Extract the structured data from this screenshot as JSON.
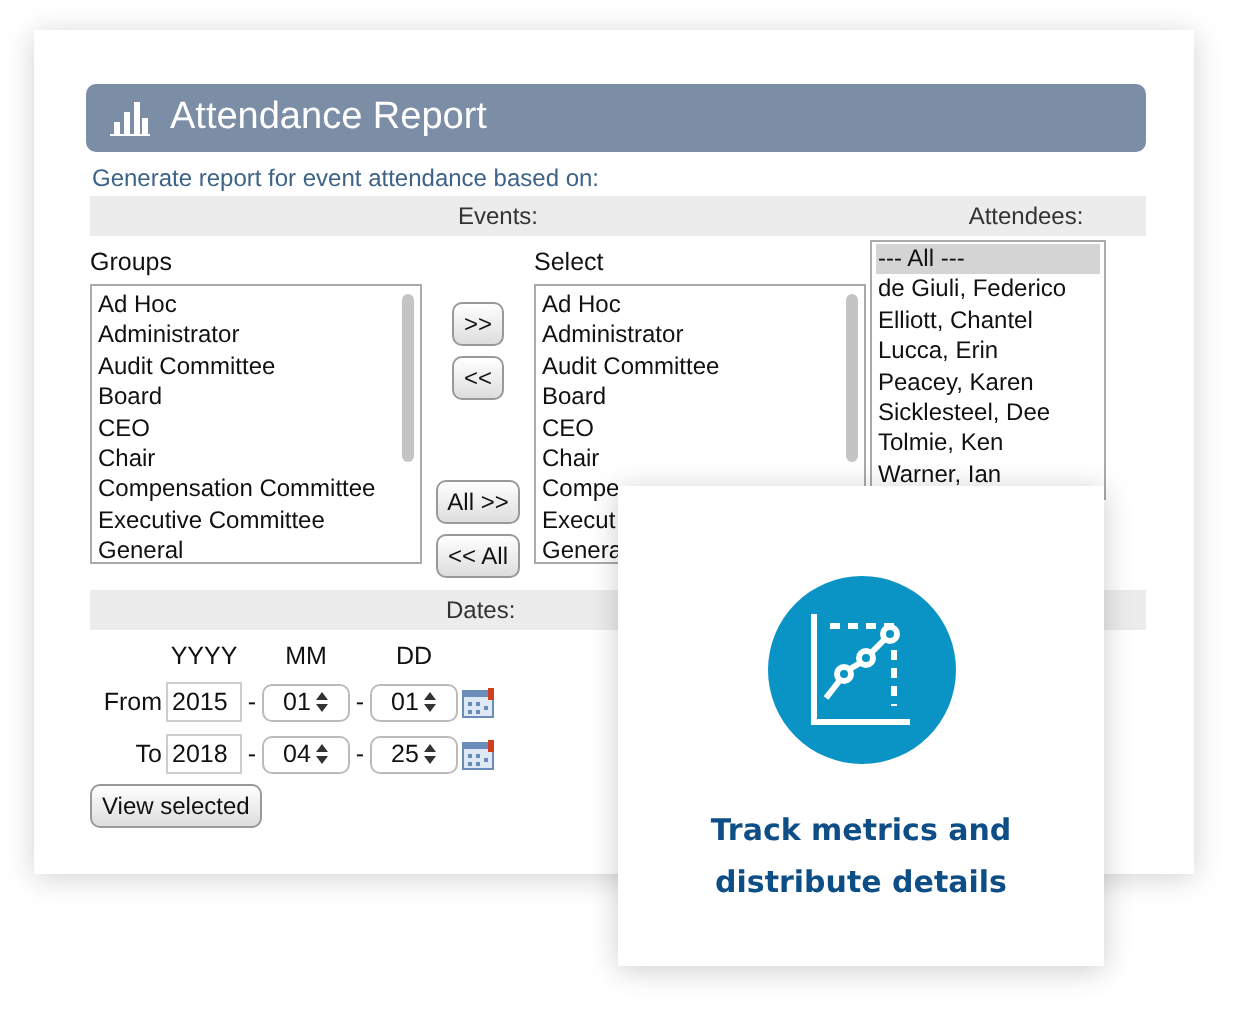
{
  "header": {
    "title": "Attendance Report"
  },
  "intro": "Generate report for event attendance based on:",
  "events": {
    "label": "Events:",
    "attendees_label": "Attendees:"
  },
  "groups": {
    "label": "Groups",
    "items": [
      "Ad Hoc",
      "Administrator",
      "Audit Committee",
      "Board",
      "CEO",
      "Chair",
      "Compensation Committee",
      "Executive Committee",
      "General"
    ]
  },
  "buttons": [
    ">>",
    "<<",
    "All >>",
    "<< All"
  ],
  "select": {
    "label": "Select",
    "items": [
      "Ad Hoc",
      "Administrator",
      "Audit Committee",
      "Board",
      "CEO",
      "Chair",
      "Compe",
      "Execut",
      "Genera"
    ]
  },
  "attendees": [
    {
      "name": "--- All ---",
      "selected": true
    },
    {
      "name": "de Giuli, Federico",
      "selected": false
    },
    {
      "name": "Elliott, Chantel",
      "selected": false
    },
    {
      "name": "Lucca, Erin",
      "selected": false
    },
    {
      "name": "Peacey, Karen",
      "selected": false
    },
    {
      "name": "Sicklesteel, Dee",
      "selected": false
    },
    {
      "name": "Tolmie, Ken",
      "selected": false
    },
    {
      "name": "Warner, Ian",
      "selected": false
    }
  ],
  "dates": {
    "label": "Dates:",
    "columns": [
      "YYYY",
      "MM",
      "DD"
    ],
    "rows": [
      {
        "label": "From",
        "year": "2015",
        "separators": [
          "-",
          "-"
        ],
        "month": "01",
        "day": "01"
      },
      {
        "label": "To",
        "year": "2018",
        "separators": [
          "-",
          "-"
        ],
        "month": "04",
        "day": "25"
      }
    ]
  },
  "view_button": "View selected",
  "promo": {
    "text": "Track metrics and distribute details"
  }
}
